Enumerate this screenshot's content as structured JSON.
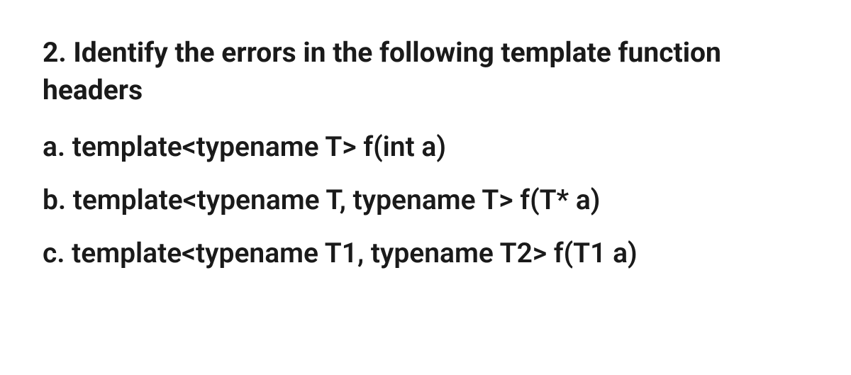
{
  "question": {
    "heading": "2. Identify the errors in the following template function headers",
    "options": {
      "a": "a. template<typename T> f(int a)",
      "b": "b. template<typename T, typename T> f(T* a)",
      "c": "c. template<typename T1, typename T2> f(T1 a)"
    }
  }
}
